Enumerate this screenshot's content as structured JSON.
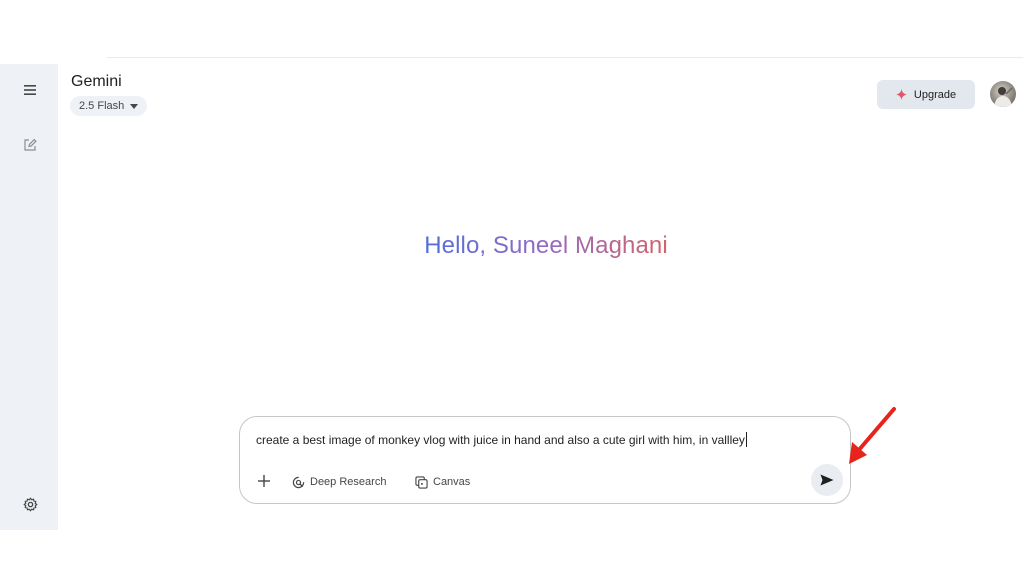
{
  "header": {
    "app_title": "Gemini",
    "model_label": "2.5 Flash",
    "upgrade_label": "Upgrade"
  },
  "main": {
    "greeting": "Hello, Suneel Maghani"
  },
  "composer": {
    "prompt_text": "create a best image of monkey vlog with juice in hand and also a cute girl with him, in vallley",
    "tools": [
      "Deep Research",
      "Canvas"
    ]
  },
  "icons": {
    "menu": "menu-icon",
    "new_chat": "edit-icon",
    "settings": "gear-icon",
    "upgrade": "sparkle-icon",
    "add": "plus-icon",
    "deep_research": "deep-research-icon",
    "canvas": "canvas-icon",
    "send": "send-icon",
    "annotation": "red-arrow-icon"
  },
  "colors": {
    "sidebar_bg": "#eef1f5",
    "greeting_gradient_start": "#4f6fdb",
    "greeting_gradient_end": "#d4626a",
    "sparkle": "#e0566b",
    "annotation_arrow": "#e8231b"
  }
}
